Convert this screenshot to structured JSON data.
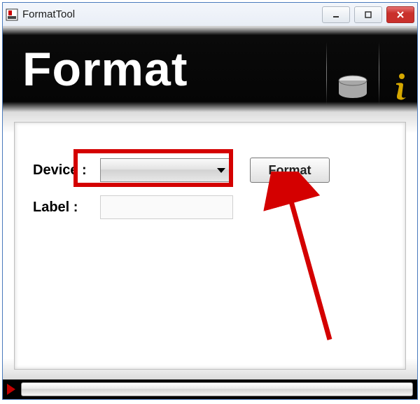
{
  "titlebar": {
    "title": "FormatTool"
  },
  "banner": {
    "heading": "Format"
  },
  "form": {
    "device_label": "Device :",
    "device_value": "",
    "label_label": "Label :",
    "label_value": "",
    "format_button": "Format"
  },
  "icons": {
    "app": "app-icon",
    "minimize": "minimize-icon",
    "maximize": "maximize-icon",
    "close": "close-icon",
    "drive": "drive-icon",
    "info": "info-icon",
    "play": "play-icon"
  }
}
